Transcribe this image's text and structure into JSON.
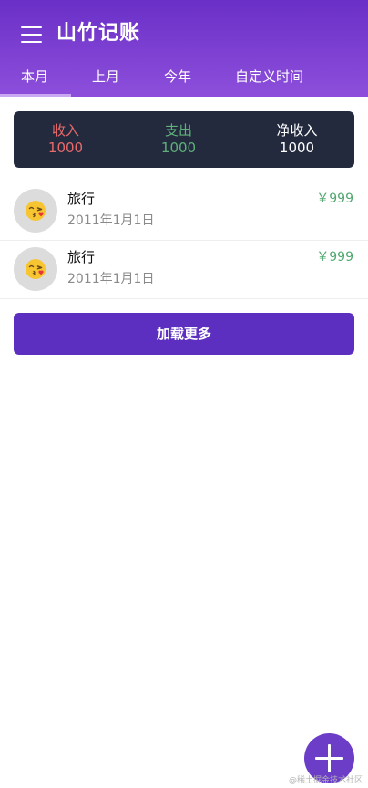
{
  "app": {
    "title": "山竹记账"
  },
  "tabs": [
    {
      "label": "本月",
      "selected": true
    },
    {
      "label": "上月",
      "selected": false
    },
    {
      "label": "今年",
      "selected": false
    },
    {
      "label": "自定义时间",
      "selected": false
    }
  ],
  "summary": {
    "income": {
      "label": "收入",
      "value": "1000",
      "color": "#e86a6a"
    },
    "expense": {
      "label": "支出",
      "value": "1000",
      "color": "#5fb07a"
    },
    "net": {
      "label": "净收入",
      "value": "1000",
      "color": "#ffffff"
    }
  },
  "records": [
    {
      "title": "旅行",
      "date": "2011年1月1日",
      "amount": "￥999",
      "icon": "kissing-face-emoji",
      "emoji": "😘"
    },
    {
      "title": "旅行",
      "date": "2011年1月1日",
      "amount": "￥999",
      "icon": "kissing-face-emoji",
      "emoji": "😘"
    }
  ],
  "load_more": {
    "label": "加载更多"
  },
  "fab": {
    "icon": "plus-icon"
  },
  "watermark": "@稀土掘金技术社区",
  "colors": {
    "header_start": "#6a2fc7",
    "header_end": "#8d4fdb",
    "summary_bg": "#232a3e",
    "button_bg": "#5c2fc0",
    "amount": "#4fa86e"
  }
}
